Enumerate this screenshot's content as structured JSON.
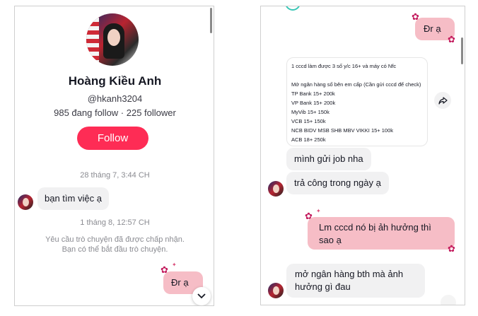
{
  "left_panel": {
    "profile": {
      "name": "Hoàng Kiều Anh",
      "handle": "@hkanh3204",
      "stats": "985 đang follow · 225 follower",
      "follow_label": "Follow"
    },
    "messages": [
      {
        "type": "timestamp",
        "text": "28 tháng 7, 3:44 CH"
      },
      {
        "type": "incoming",
        "text": "bạn tìm việc ạ"
      },
      {
        "type": "timestamp",
        "text": "1 tháng 8, 12:57 CH"
      },
      {
        "type": "system",
        "lines": [
          "Yêu cầu trò chuyện đã được chấp nhận.",
          "Bạn có thể bắt đầu trò chuyện."
        ]
      },
      {
        "type": "outgoing",
        "text": "Đr ạ"
      }
    ]
  },
  "right_panel": {
    "messages": [
      {
        "type": "outgoing",
        "text": "Đr ạ"
      },
      {
        "type": "card",
        "lines": [
          "1 cccd làm được 3 số y/c 16+ và máy có Nfc",
          "",
          "Mở ngân hàng số bên em cấp (Cần gửi cccd để check)",
          "TP Bank 15+ 200k",
          "VP Bank 15+ 200k",
          "MyVib 15+ 150k",
          "VCB 15+ 150k",
          "NCB BIDV MSB SHB MBV VIKKI 15+ 100k",
          "ACB 18+ 250k"
        ]
      },
      {
        "type": "incoming",
        "text": "mình gửi job nha"
      },
      {
        "type": "incoming",
        "text": "trả công trong ngày ạ"
      },
      {
        "type": "outgoing",
        "text": "Lm cccd nó bị ảh hưởng thì sao ạ"
      },
      {
        "type": "incoming",
        "text": "mở ngân hàng bth mà ảnh hưởng gì đau"
      }
    ]
  },
  "icons": {
    "scroll_down": "chevron-down-icon",
    "share": "share-arrow-icon",
    "sticker": "flower-icon"
  },
  "colors": {
    "follow": "#fe2c55",
    "bubble_out": "#f6bdc6",
    "bubble_in": "#f1f1f2",
    "flower": "#c2185b"
  }
}
